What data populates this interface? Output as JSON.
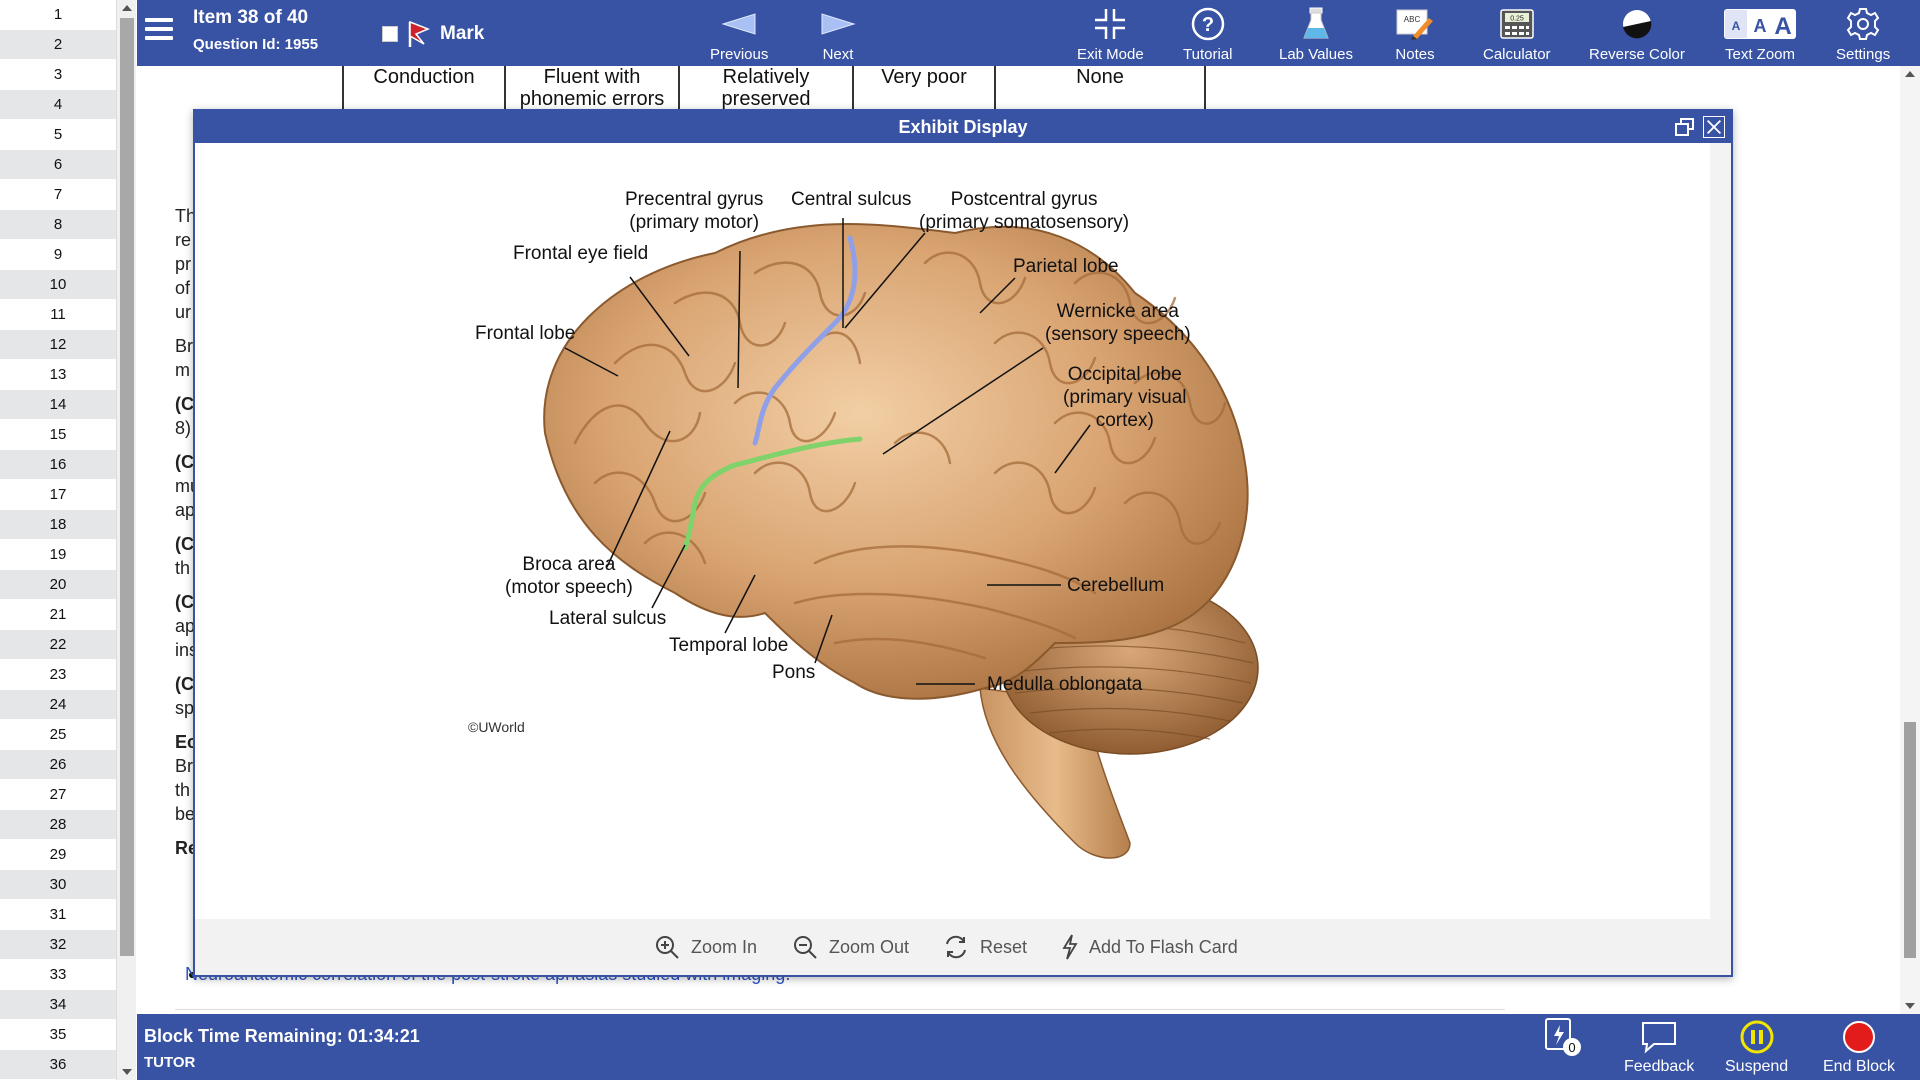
{
  "nav": {
    "items": [
      "1",
      "2",
      "3",
      "4",
      "5",
      "6",
      "7",
      "8",
      "9",
      "10",
      "11",
      "12",
      "13",
      "14",
      "15",
      "16",
      "17",
      "18",
      "19",
      "20",
      "21",
      "22",
      "23",
      "24",
      "25",
      "26",
      "27",
      "28",
      "29",
      "30",
      "31",
      "32",
      "33",
      "34",
      "35",
      "36"
    ]
  },
  "topbar": {
    "item_title": "Item 38 of 40",
    "question_id": "Question Id: 1955",
    "mark_label": "Mark",
    "previous_label": "Previous",
    "next_label": "Next",
    "exit_mode_label": "Exit Mode",
    "tutorial_label": "Tutorial",
    "lab_values_label": "Lab Values",
    "notes_label": "Notes",
    "calculator_label": "Calculator",
    "calculator_display": "0.25",
    "notes_icon_text": "ABC",
    "reverse_color_label": "Reverse Color",
    "text_zoom_label": "Text Zoom",
    "settings_label": "Settings"
  },
  "background": {
    "table_row": [
      "Conduction",
      "Fluent with phonemic errors",
      "Relatively preserved",
      "Very poor",
      "None"
    ],
    "text_fragments": [
      {
        "text": "Th",
        "bold": false
      },
      {
        "text": "re",
        "bold": false
      },
      {
        "text": "pr",
        "bold": false
      },
      {
        "text": "of",
        "bold": false
      },
      {
        "text": "ur",
        "bold": false
      },
      {
        "text": "Br",
        "bold": false
      },
      {
        "text": "m",
        "bold": false
      },
      {
        "text": "(C",
        "bold": true
      },
      {
        "text": "8)",
        "bold": false
      },
      {
        "text": "(C",
        "bold": true
      },
      {
        "text": "mu",
        "bold": false
      },
      {
        "text": "ap",
        "bold": false
      },
      {
        "text": "(C",
        "bold": true
      },
      {
        "text": "th",
        "bold": false
      },
      {
        "text": "(C",
        "bold": true
      },
      {
        "text": "ap",
        "bold": false
      },
      {
        "text": "ins",
        "bold": false
      },
      {
        "text": "(C",
        "bold": true
      },
      {
        "text": "sp",
        "bold": false
      },
      {
        "text": "Ec",
        "bold": true
      },
      {
        "text": "Br",
        "bold": false
      },
      {
        "text": "th",
        "bold": false
      },
      {
        "text": "be",
        "bold": false
      },
      {
        "text": "Re",
        "bold": true
      }
    ],
    "reference_link": "Neuroanatomic correlation of the post-stroke aphasias studied with imaging."
  },
  "exhibit": {
    "title": "Exhibit Display",
    "labels": {
      "precentral": [
        "Precentral gyrus",
        "(primary motor)"
      ],
      "central_sulcus": "Central sulcus",
      "postcentral": [
        "Postcentral gyrus",
        "(primary somatosensory)"
      ],
      "frontal_eye": "Frontal eye field",
      "parietal": "Parietal lobe",
      "wernicke": [
        "Wernicke area",
        "(sensory speech)"
      ],
      "frontal_lobe": "Frontal lobe",
      "occipital": [
        "Occipital lobe",
        "(primary visual",
        "cortex)"
      ],
      "broca": [
        "Broca area",
        "(motor speech)"
      ],
      "lateral_sulcus": "Lateral sulcus",
      "temporal": "Temporal lobe",
      "cerebellum": "Cerebellum",
      "pons": "Pons",
      "medulla": "Medulla oblongata"
    },
    "copyright": "©UWorld",
    "tools": {
      "zoom_in": "Zoom In",
      "zoom_out": "Zoom Out",
      "reset": "Reset",
      "flash_card": "Add To Flash Card"
    }
  },
  "bottombar": {
    "time_remaining": "Block Time Remaining: 01:34:21",
    "mode": "TUTOR",
    "flashcard_count": "0",
    "feedback_label": "Feedback",
    "suspend_label": "Suspend",
    "end_block_label": "End Block"
  },
  "colors": {
    "bar_blue": "#3852a4",
    "central_sulcus_line": "#8fa0e8",
    "lateral_sulcus_line": "#7fd36a",
    "end_block_red": "#e21b1b",
    "suspend_yellow": "#f2e500"
  }
}
